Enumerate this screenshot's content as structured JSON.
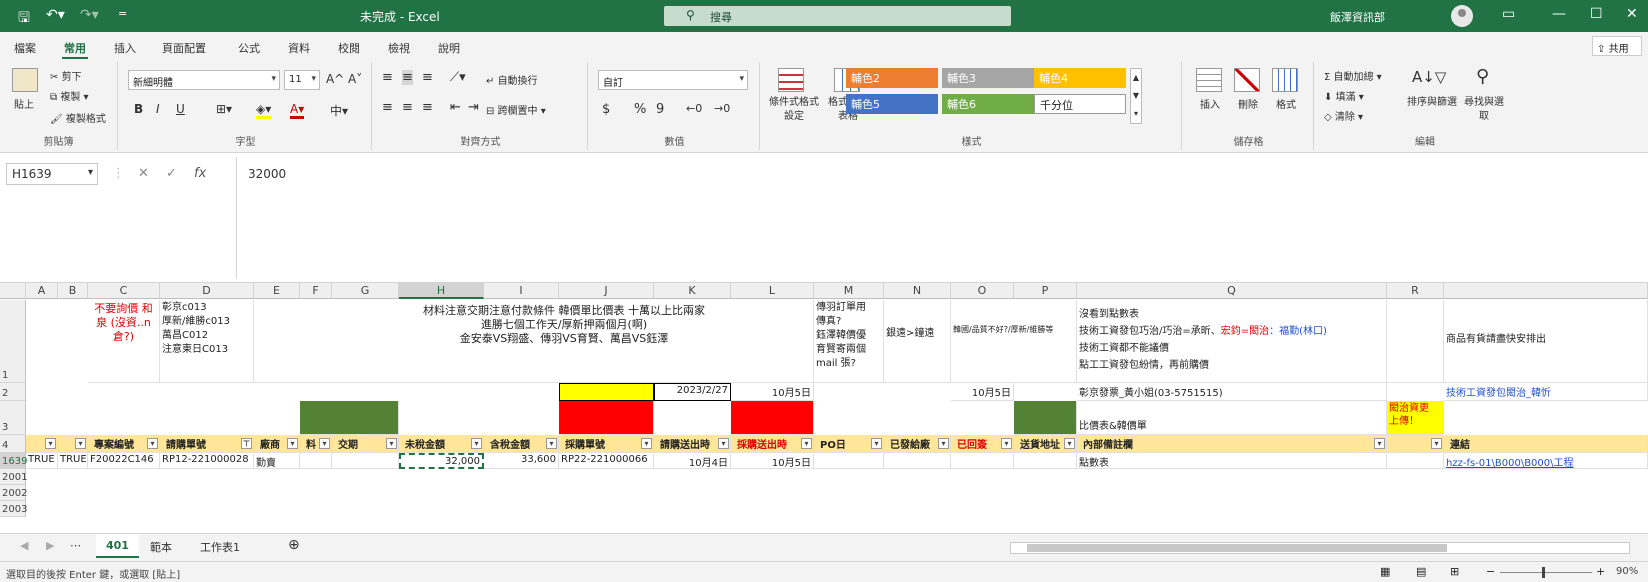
{
  "titlebar": {
    "doc_title": "未完成 - Excel",
    "search_placeholder": "搜尋",
    "user": "飯澤資訊部",
    "save_icon": "save-icon",
    "undo_icon": "undo-icon",
    "redo_icon": "redo-icon"
  },
  "tabs": [
    "檔案",
    "常用",
    "插入",
    "頁面配置",
    "公式",
    "資料",
    "校閱",
    "檢視",
    "說明"
  ],
  "share_label": "共用",
  "ribbon": {
    "clipboard": {
      "cut": "剪下",
      "copy": "複製",
      "paste": "貼上",
      "format_painter": "複製格式",
      "label": "剪貼簿"
    },
    "font": {
      "name": "新細明體",
      "size": "11",
      "bold": "B",
      "italic": "I",
      "underline": "U",
      "grow": "A^",
      "shrink": "A˅",
      "label": "字型"
    },
    "alignment": {
      "wrap": "自動換行",
      "merge": "跨欄置中",
      "label": "對齊方式"
    },
    "number": {
      "format": "自訂",
      "currency": "$",
      "percent": "%",
      "comma": "9",
      "label": "數值"
    },
    "styles": {
      "cond_format": "條件式格式設定",
      "format_table": "格式化為表格",
      "cells": [
        {
          "label": "輔色2",
          "color": "#ed7d31",
          "text_color": "#ffffff"
        },
        {
          "label": "輔色3",
          "color": "#a5a5a5",
          "text_color": "#ffffff"
        },
        {
          "label": "輔色4",
          "color": "#ffc000",
          "text_color": "#ffffff"
        },
        {
          "label": "輔色5",
          "color": "#4472c4",
          "text_color": "#ffffff"
        },
        {
          "label": "輔色6",
          "color": "#70ad47",
          "text_color": "#ffffff"
        },
        {
          "label": "千分位",
          "color": "#ffffff",
          "text_color": "#222222"
        }
      ],
      "label": "樣式"
    },
    "cells_group": {
      "insert": "插入",
      "delete": "刪除",
      "format": "格式",
      "label": "儲存格"
    },
    "editing": {
      "autosum": "自動加總",
      "fill": "填滿",
      "clear": "清除",
      "sort": "排序與篩選",
      "find": "尋找與選取",
      "label": "編輯"
    }
  },
  "formula": {
    "namebox": "H1639",
    "cancel": "✕",
    "enter": "✓",
    "fx": "fx",
    "value": "32000"
  },
  "columns": [
    {
      "label": "A"
    },
    {
      "label": "B"
    },
    {
      "label": "C"
    },
    {
      "label": "D"
    },
    {
      "label": "E"
    },
    {
      "label": "F"
    },
    {
      "label": "G"
    },
    {
      "label": "H"
    },
    {
      "label": "I"
    },
    {
      "label": "J"
    },
    {
      "label": "K"
    },
    {
      "label": "L"
    },
    {
      "label": "M"
    },
    {
      "label": "N"
    },
    {
      "label": "O"
    },
    {
      "label": "P"
    },
    {
      "label": "Q"
    },
    {
      "label": "R"
    },
    {
      "label": ""
    }
  ],
  "rows": [
    "1",
    "2",
    "3",
    "4",
    "1639",
    "2001",
    "2002",
    "2003"
  ],
  "row1": {
    "c": "不要詢價\n和泉\n(沒資..n倉?)",
    "d": "彰京c013\n厚新/維勝c013\n萬昌C012\n注意東日C013",
    "g_to_k": "材料注意交期注意付款條件 韓價單比價表 十萬以上比兩家\n進勝七個工作天/厚新押兩個月(啊)\n金安泰VS翔盛、傳羽VS育賢、萬昌VS鈺澤",
    "m": "傳羽訂單用\n傳真?\n鈺澤韓價優\n育賢寄兩個\nmail 張?",
    "n": "銀遠>鐘遠",
    "o": "韓國/品質不好?/厚新/維勝等",
    "q_line1": "沒看到點數表",
    "q_line2a": "技術工資發包巧治/巧治=承昕、",
    "q_line2b": "宏鈞=閎治",
    "q_line2c": "：福勤(林口)",
    "q_line3": "技術工資都不能議價",
    "q_line4": "點工工資發包紛情，再前購價",
    "s": "商品有貨請盡快安排出"
  },
  "row2": {
    "k": "2023/2/27",
    "l": "10月5日",
    "o": "10月5日",
    "q": "彰京發票_黃小姐(03-5751515)",
    "s": "技術工資發包閎治_韓忻"
  },
  "row3": {
    "q": "比價表&韓價單",
    "r": "閎治資更\n上傳！"
  },
  "row4": [
    "",
    "",
    "專案編號",
    "請購單號",
    "廠商",
    "料",
    "交期",
    "未稅金額",
    "含稅金額",
    "採購單號",
    "請購送出時",
    "採購送出時",
    "PO日",
    "已發給廠",
    "已回簽",
    "送貨地址",
    "內部備註欄",
    "",
    "連結"
  ],
  "row1639": [
    "TRUE",
    "TRUE",
    "F20022C146",
    "RP12-221000028",
    "勤賣",
    "",
    "",
    "32,000",
    "33,600",
    "RP22-221000066",
    "10月4日",
    "10月5日",
    "",
    "",
    "",
    "",
    "點數表",
    "",
    "hzz-fs-01\\B000\\B000\\工程"
  ],
  "sheets": [
    "401",
    "範本",
    "工作表1"
  ],
  "status": "選取目的後按 Enter 鍵，或選取 [貼上]",
  "zoom": "90%"
}
